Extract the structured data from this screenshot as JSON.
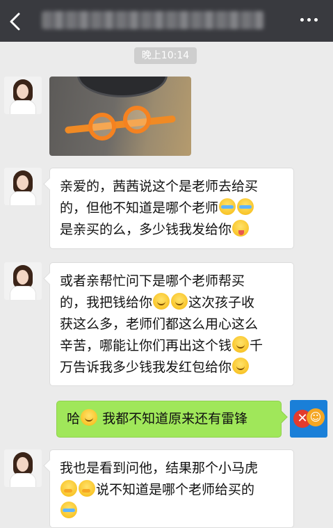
{
  "header": {
    "title_obscured": true
  },
  "timestamp": "晚上10:14",
  "messages": [
    {
      "side": "left",
      "type": "image",
      "subject": "orange-swim-goggles-photo"
    },
    {
      "side": "left",
      "type": "text",
      "lines": [
        "亲爱的，茜茜说这个是老师去给买",
        "的，但他不知道是哪个老师",
        "是亲买的么，多少钱我发给你"
      ]
    },
    {
      "side": "left",
      "type": "text",
      "lines": [
        "或者亲帮忙问下是哪个老师帮买",
        "的，我把钱给你",
        "这次孩子收",
        "获这么多，老师们都这么用心这么",
        "辛苦，哪能让你们再出这个钱",
        "千",
        "万告诉我多少钱我发红包给你"
      ]
    },
    {
      "side": "right",
      "type": "text",
      "parts": [
        "哈",
        "我都不知道原来还有雷锋"
      ]
    },
    {
      "side": "left",
      "type": "text",
      "lines": [
        "我也是看到问他，结果那个小马虎",
        "说不知道是哪个老师给买的"
      ]
    }
  ],
  "icons": [
    "back-arrow-icon",
    "more-dots-icon",
    "cry-laugh-emoji",
    "tongue-wink-emoji",
    "smile-emoji",
    "blush-smile-emoji",
    "thinking-emoji"
  ],
  "colors": {
    "topbar": "#393a3f",
    "background": "#ebebeb",
    "my_bubble": "#a0e75a",
    "their_bubble": "#ffffff"
  }
}
